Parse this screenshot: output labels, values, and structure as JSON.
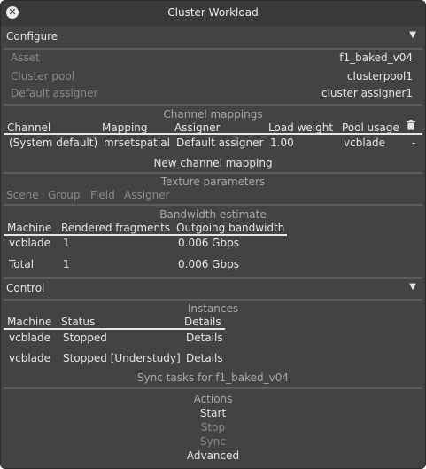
{
  "window": {
    "title": "Cluster Workload"
  },
  "configure": {
    "header": "Configure",
    "fields": [
      {
        "label": "Asset",
        "value": "f1_baked_v04"
      },
      {
        "label": "Cluster pool",
        "value": "clusterpool1"
      },
      {
        "label": "Default assigner",
        "value": "cluster assigner1"
      }
    ]
  },
  "channel_mappings": {
    "title": "Channel mappings",
    "columns": [
      "Channel",
      "Mapping",
      "Assigner",
      "Load weight",
      "Pool usage"
    ],
    "rows": [
      {
        "channel": "(System default)",
        "mapping": "mrsetspatial",
        "assigner": "Default assigner",
        "load_weight": "1.00",
        "pool_usage": "vcblade",
        "extra": "-"
      }
    ],
    "new_button": "New channel mapping"
  },
  "texture_parameters": {
    "title": "Texture parameters",
    "columns": [
      "Scene",
      "Group",
      "Field",
      "Assigner"
    ]
  },
  "bandwidth": {
    "title": "Bandwidth estimate",
    "columns": [
      "Machine",
      "Rendered fragments",
      "Outgoing bandwidth"
    ],
    "rows": [
      {
        "machine": "vcblade",
        "fragments": "1",
        "bandwidth": "0.006 Gbps"
      },
      {
        "machine": "Total",
        "fragments": "1",
        "bandwidth": "0.006 Gbps"
      }
    ]
  },
  "control": {
    "header": "Control",
    "instances_title": "Instances",
    "columns": [
      "Machine",
      "Status",
      "Details"
    ],
    "rows": [
      {
        "machine": "vcblade",
        "status": "Stopped",
        "details": "Details"
      },
      {
        "machine": "vcblade",
        "status": "Stopped [Understudy]",
        "details": "Details"
      }
    ],
    "sync_tasks": "Sync tasks for f1_baked_v04",
    "actions_title": "Actions",
    "actions": [
      "Start",
      "Stop",
      "Sync",
      "Advanced"
    ]
  },
  "icons": {
    "close": "close-icon",
    "collapse": "triangle-down-icon",
    "trash": "trash-icon"
  }
}
